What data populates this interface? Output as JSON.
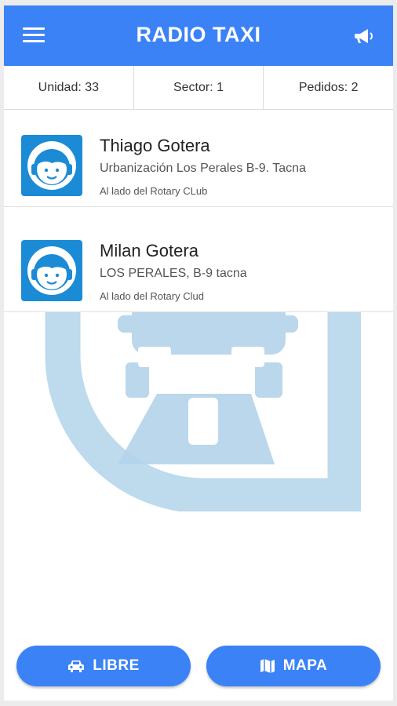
{
  "header": {
    "title": "RADIO TAXI"
  },
  "status": {
    "unidad": "Unidad: 33",
    "sector": "Sector: 1",
    "pedidos": "Pedidos: 2"
  },
  "orders": [
    {
      "name": "Thiago Gotera",
      "address": "Urbanización Los Perales B-9. Tacna",
      "reference": "Al lado del Rotary CLub"
    },
    {
      "name": "Milan Gotera",
      "address": "LOS PERALES, B-9 tacna",
      "reference": "Al lado del Rotary Clud"
    }
  ],
  "actions": {
    "libre_label": "LIBRE",
    "mapa_label": "MAPA"
  },
  "colors": {
    "primary": "#3b82f6",
    "avatar_bg": "#1b8bd6",
    "watermark": "#b3d3ea"
  },
  "icons": {
    "menu": "menu-icon",
    "announce": "megaphone-icon",
    "avatar": "operator-headset-icon",
    "libre": "car-icon",
    "mapa": "map-icon"
  }
}
